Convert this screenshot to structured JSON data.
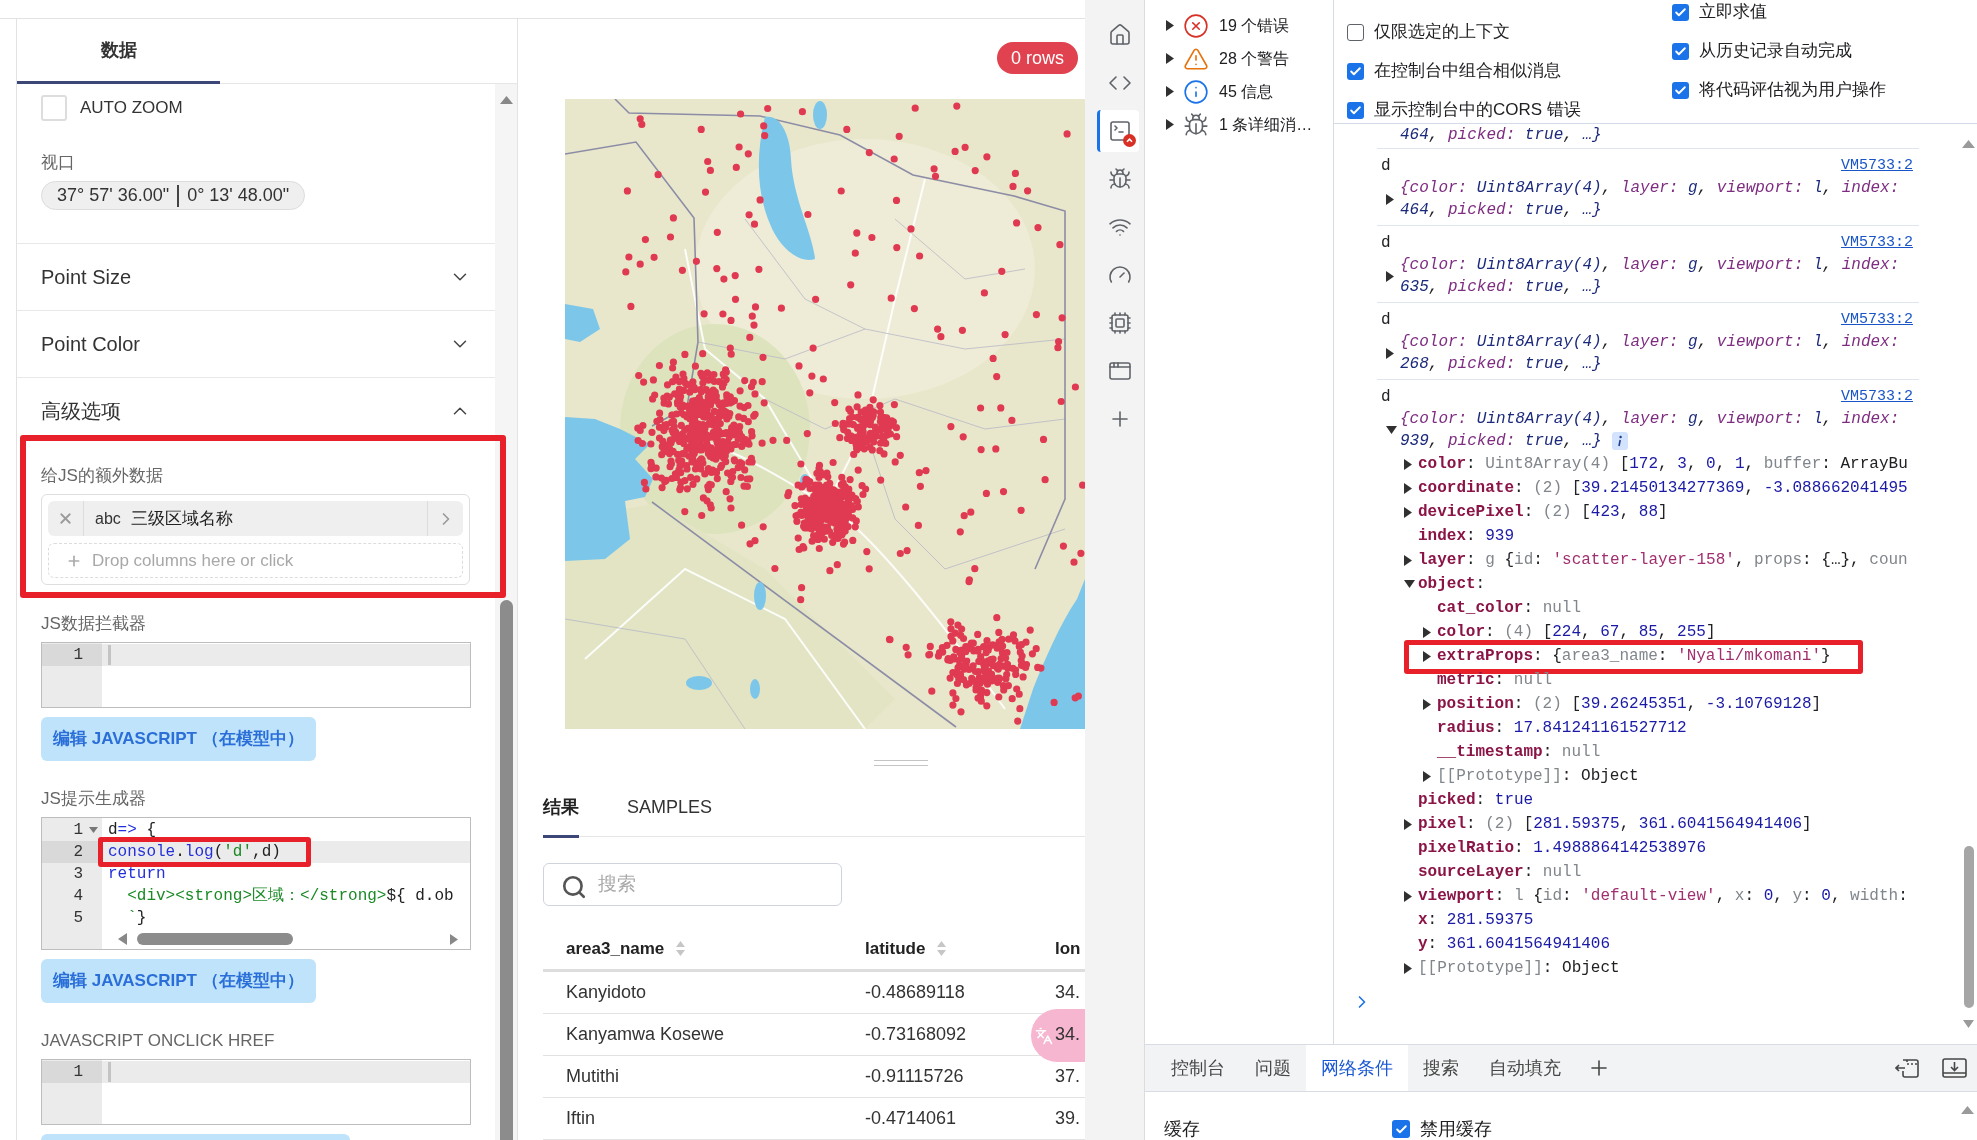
{
  "left_panel": {
    "tabs": [
      {
        "label": "数据",
        "selected": true
      }
    ],
    "auto_zoom": {
      "label": "AUTO ZOOM",
      "checked": false
    },
    "viewport": {
      "label": "视口",
      "latitude": "37° 57' 36.00\"",
      "longitude": "0° 13' 48.00\""
    },
    "sections": [
      {
        "title": "Point Size",
        "expanded": false
      },
      {
        "title": "Point Color",
        "expanded": false
      },
      {
        "title": "高级选项",
        "expanded": true,
        "body": {
          "extra_data": {
            "label": "给JS的额外数据",
            "annotated": true,
            "columns": [
              {
                "type": "abc",
                "name": "三级区域名称"
              }
            ],
            "drop_placeholder": "Drop columns here or click"
          },
          "editors": [
            {
              "label": "JS数据拦截器",
              "cursor": true,
              "h_scroll": false,
              "lines": [
                {
                  "number": "1",
                  "active": true,
                  "foldable": false,
                  "annotated": false
                }
              ],
              "has_button": true,
              "button": "编辑 JAVASCRIPT （在模型中）"
            },
            {
              "label": "JS提示生成器",
              "cursor": false,
              "h_scroll": true,
              "lines": [
                {
                  "number": "1",
                  "active": false,
                  "foldable": true,
                  "annotated": false,
                  "tokens": [
                    {
                      "kind": "plain",
                      "text": "d"
                    },
                    {
                      "kind": "keyword",
                      "text": "=>"
                    },
                    {
                      "kind": "plain",
                      "text": " {"
                    }
                  ]
                },
                {
                  "number": "2",
                  "active": true,
                  "foldable": false,
                  "annotated": true,
                  "tokens": [
                    {
                      "kind": "keyword",
                      "text": "console"
                    },
                    {
                      "kind": "plain",
                      "text": "."
                    },
                    {
                      "kind": "keyword",
                      "text": "log"
                    },
                    {
                      "kind": "plain",
                      "text": "("
                    },
                    {
                      "kind": "string",
                      "text": "'d'"
                    },
                    {
                      "kind": "plain",
                      "text": ",d)"
                    }
                  ]
                },
                {
                  "number": "3",
                  "active": false,
                  "foldable": false,
                  "annotated": false,
                  "tokens": [
                    {
                      "kind": "keyword",
                      "text": "return"
                    }
                  ]
                },
                {
                  "number": "4",
                  "active": false,
                  "foldable": false,
                  "annotated": false,
                  "tokens": [
                    {
                      "kind": "string",
                      "text": "  <div><strong>区域：</strong>"
                    },
                    {
                      "kind": "plain",
                      "text": "${ d.ob"
                    }
                  ]
                },
                {
                  "number": "5",
                  "active": false,
                  "foldable": false,
                  "annotated": false,
                  "tokens": [
                    {
                      "kind": "string",
                      "text": "  `"
                    },
                    {
                      "kind": "plain",
                      "text": "}"
                    }
                  ]
                }
              ],
              "has_button": true,
              "button": "编辑 JAVASCRIPT （在模型中）"
            },
            {
              "label": "JAVASCRIPT ONCLICK HREF",
              "cursor": true,
              "h_scroll": false,
              "lines": [
                {
                  "number": "1",
                  "active": true,
                  "foldable": false,
                  "annotated": false
                }
              ],
              "has_button": true
            }
          ]
        }
      }
    ]
  },
  "results": {
    "row_count": "0 rows",
    "tabs": [
      {
        "label": "结果",
        "selected": true
      },
      {
        "label": "SAMPLES",
        "selected": false
      }
    ],
    "search": {
      "placeholder": "搜索"
    },
    "table": {
      "columns": [
        {
          "label": "area3_name",
          "sortable": true
        },
        {
          "label": "latitude",
          "sortable": true
        },
        {
          "label": "lon",
          "sortable": false
        }
      ],
      "rows": [
        [
          "Kanyidoto",
          "-0.48689118",
          "34."
        ],
        [
          "Kanyamwa Kosewe",
          "-0.73168092",
          "34."
        ],
        [
          "Mutithi",
          "-0.91115726",
          "37."
        ],
        [
          "Iftin",
          "-0.4714061",
          "39."
        ]
      ]
    }
  },
  "devtools": {
    "activity_bar": [
      {
        "selected": false,
        "badge": false
      },
      {
        "selected": false,
        "badge": false
      },
      {
        "selected": true,
        "badge": true
      },
      {
        "selected": false,
        "badge": false
      },
      {
        "selected": false,
        "badge": false
      },
      {
        "selected": false,
        "badge": false
      },
      {
        "selected": false,
        "badge": false
      },
      {
        "selected": false,
        "badge": false
      },
      {
        "selected": false,
        "badge": false
      }
    ],
    "message_filters": [
      {
        "kind": "error",
        "label": "19 个错误",
        "expanded": false
      },
      {
        "kind": "warning",
        "label": "28 个警告",
        "expanded": false
      },
      {
        "kind": "info",
        "label": "45 信息",
        "expanded": false
      },
      {
        "kind": "verbose",
        "label": "1 条详细消…",
        "expanded": false
      }
    ],
    "console_settings": [
      [
        {
          "label": "仅限选定的上下文",
          "checked": false
        },
        {
          "label": "在控制台中组合相似消息",
          "checked": true
        },
        {
          "label": "显示控制台中的CORS 错误",
          "checked": true
        }
      ],
      [
        {
          "label": "立即求值",
          "checked": true
        },
        {
          "label": "从历史记录自动完成",
          "checked": true
        },
        {
          "label": "将代码评估视为用户操作",
          "checked": true
        }
      ]
    ],
    "console": {
      "tail": [
        {
          "kind": "pval",
          "text": "464"
        },
        {
          "kind": "plain",
          "text": ", "
        },
        {
          "kind": "pkey",
          "text": "picked:"
        },
        {
          "kind": "pval",
          "text": " true"
        },
        {
          "kind": "plain",
          "text": ", "
        },
        {
          "kind": "pval",
          "text": "…}"
        }
      ],
      "messages": [
        {
          "label": "d",
          "source": "VM5733:2",
          "expanded": false,
          "preview": [
            [
              {
                "kind": "pkey",
                "text": "{color:"
              },
              {
                "kind": "pval",
                "text": " Uint8Array(4)"
              },
              {
                "kind": "plain",
                "text": ", "
              },
              {
                "kind": "pkey",
                "text": "layer:"
              },
              {
                "kind": "pval",
                "text": " g"
              },
              {
                "kind": "plain",
                "text": ", "
              },
              {
                "kind": "pkey",
                "text": "viewport:"
              },
              {
                "kind": "pval",
                "text": " l"
              },
              {
                "kind": "plain",
                "text": ", "
              },
              {
                "kind": "pkey",
                "text": "index:"
              }
            ],
            [
              {
                "kind": "pval",
                "text": "464"
              },
              {
                "kind": "plain",
                "text": ", "
              },
              {
                "kind": "pkey",
                "text": "picked:"
              },
              {
                "kind": "pval",
                "text": " true"
              },
              {
                "kind": "plain",
                "text": ", "
              },
              {
                "kind": "pval",
                "text": "…}"
              }
            ]
          ]
        },
        {
          "label": "d",
          "source": "VM5733:2",
          "expanded": false,
          "preview": [
            [
              {
                "kind": "pkey",
                "text": "{color:"
              },
              {
                "kind": "pval",
                "text": " Uint8Array(4)"
              },
              {
                "kind": "plain",
                "text": ", "
              },
              {
                "kind": "pkey",
                "text": "layer:"
              },
              {
                "kind": "pval",
                "text": " g"
              },
              {
                "kind": "plain",
                "text": ", "
              },
              {
                "kind": "pkey",
                "text": "viewport:"
              },
              {
                "kind": "pval",
                "text": " l"
              },
              {
                "kind": "plain",
                "text": ", "
              },
              {
                "kind": "pkey",
                "text": "index:"
              }
            ],
            [
              {
                "kind": "pval",
                "text": "635"
              },
              {
                "kind": "plain",
                "text": ", "
              },
              {
                "kind": "pkey",
                "text": "picked:"
              },
              {
                "kind": "pval",
                "text": " true"
              },
              {
                "kind": "plain",
                "text": ", "
              },
              {
                "kind": "pval",
                "text": "…}"
              }
            ]
          ]
        },
        {
          "label": "d",
          "source": "VM5733:2",
          "expanded": false,
          "preview": [
            [
              {
                "kind": "pkey",
                "text": "{color:"
              },
              {
                "kind": "pval",
                "text": " Uint8Array(4)"
              },
              {
                "kind": "plain",
                "text": ", "
              },
              {
                "kind": "pkey",
                "text": "layer:"
              },
              {
                "kind": "pval",
                "text": " g"
              },
              {
                "kind": "plain",
                "text": ", "
              },
              {
                "kind": "pkey",
                "text": "viewport:"
              },
              {
                "kind": "pval",
                "text": " l"
              },
              {
                "kind": "plain",
                "text": ", "
              },
              {
                "kind": "pkey",
                "text": "index:"
              }
            ],
            [
              {
                "kind": "pval",
                "text": "268"
              },
              {
                "kind": "plain",
                "text": ", "
              },
              {
                "kind": "pkey",
                "text": "picked:"
              },
              {
                "kind": "pval",
                "text": " true"
              },
              {
                "kind": "plain",
                "text": ", "
              },
              {
                "kind": "pval",
                "text": "…}"
              }
            ]
          ]
        },
        {
          "label": "d",
          "source": "VM5733:2",
          "expanded": true,
          "preview": [
            [
              {
                "kind": "pkey",
                "text": "{color:"
              },
              {
                "kind": "pval",
                "text": " Uint8Array(4)"
              },
              {
                "kind": "plain",
                "text": ", "
              },
              {
                "kind": "pkey",
                "text": "layer:"
              },
              {
                "kind": "pval",
                "text": " g"
              },
              {
                "kind": "plain",
                "text": ", "
              },
              {
                "kind": "pkey",
                "text": "viewport:"
              },
              {
                "kind": "pval",
                "text": " l"
              },
              {
                "kind": "plain",
                "text": ", "
              },
              {
                "kind": "pkey",
                "text": "index:"
              }
            ],
            [
              {
                "kind": "pval",
                "text": "939"
              },
              {
                "kind": "plain",
                "text": ", "
              },
              {
                "kind": "pkey",
                "text": "picked:"
              },
              {
                "kind": "pval",
                "text": " true"
              },
              {
                "kind": "plain",
                "text": ", "
              },
              {
                "kind": "pval",
                "text": "…}"
              }
            ]
          ],
          "children": [
            {
              "kind": "node",
              "expanded": false,
              "tokens": [
                {
                  "kind": "key",
                  "text": "color"
                },
                {
                  "kind": "plain",
                  "text": ": "
                },
                {
                  "kind": "gray",
                  "text": "Uint8Array(4)"
                },
                {
                  "kind": "plain",
                  "text": " ["
                },
                {
                  "kind": "num",
                  "text": "172"
                },
                {
                  "kind": "plain",
                  "text": ", "
                },
                {
                  "kind": "num",
                  "text": "3"
                },
                {
                  "kind": "plain",
                  "text": ", "
                },
                {
                  "kind": "num",
                  "text": "0"
                },
                {
                  "kind": "plain",
                  "text": ", "
                },
                {
                  "kind": "num",
                  "text": "1"
                },
                {
                  "kind": "plain",
                  "text": ", "
                },
                {
                  "kind": "gray",
                  "text": "buffer"
                },
                {
                  "kind": "plain",
                  "text": ": ArrayBu"
                }
              ]
            },
            {
              "kind": "node",
              "expanded": false,
              "tokens": [
                {
                  "kind": "key",
                  "text": "coordinate"
                },
                {
                  "kind": "plain",
                  "text": ": "
                },
                {
                  "kind": "gray",
                  "text": "(2)"
                },
                {
                  "kind": "plain",
                  "text": " ["
                },
                {
                  "kind": "num",
                  "text": "39.21450134277369"
                },
                {
                  "kind": "plain",
                  "text": ", "
                },
                {
                  "kind": "num",
                  "text": "-3.088662041495"
                }
              ]
            },
            {
              "kind": "node",
              "expanded": false,
              "tokens": [
                {
                  "kind": "key",
                  "text": "devicePixel"
                },
                {
                  "kind": "plain",
                  "text": ": "
                },
                {
                  "kind": "gray",
                  "text": "(2)"
                },
                {
                  "kind": "plain",
                  "text": " ["
                },
                {
                  "kind": "num",
                  "text": "423"
                },
                {
                  "kind": "plain",
                  "text": ", "
                },
                {
                  "kind": "num",
                  "text": "88"
                },
                {
                  "kind": "plain",
                  "text": "]"
                }
              ]
            },
            {
              "kind": "leaf",
              "tokens": [
                {
                  "kind": "key",
                  "text": "index"
                },
                {
                  "kind": "plain",
                  "text": ": "
                },
                {
                  "kind": "num",
                  "text": "939"
                }
              ]
            },
            {
              "kind": "node",
              "expanded": false,
              "tokens": [
                {
                  "kind": "key",
                  "text": "layer"
                },
                {
                  "kind": "plain",
                  "text": ": "
                },
                {
                  "kind": "gray",
                  "text": "g"
                },
                {
                  "kind": "plain",
                  "text": " {"
                },
                {
                  "kind": "gray",
                  "text": "id"
                },
                {
                  "kind": "plain",
                  "text": ": "
                },
                {
                  "kind": "str",
                  "text": "'scatter-layer-158'"
                },
                {
                  "kind": "plain",
                  "text": ", "
                },
                {
                  "kind": "gray",
                  "text": "props"
                },
                {
                  "kind": "plain",
                  "text": ": {…}, "
                },
                {
                  "kind": "gray",
                  "text": "coun"
                }
              ]
            },
            {
              "kind": "node",
              "expanded": true,
              "tokens": [
                {
                  "kind": "key",
                  "text": "object"
                },
                {
                  "kind": "plain",
                  "text": ":"
                }
              ],
              "children": [
                {
                  "kind": "leaf",
                  "annotated": false,
                  "tokens": [
                    {
                      "kind": "key",
                      "text": "cat_color"
                    },
                    {
                      "kind": "plain",
                      "text": ": "
                    },
                    {
                      "kind": "gray",
                      "text": "null"
                    }
                  ]
                },
                {
                  "kind": "node",
                  "expanded": false,
                  "annotated": false,
                  "tokens": [
                    {
                      "kind": "key",
                      "text": "color"
                    },
                    {
                      "kind": "plain",
                      "text": ": "
                    },
                    {
                      "kind": "gray",
                      "text": "(4)"
                    },
                    {
                      "kind": "plain",
                      "text": " ["
                    },
                    {
                      "kind": "num",
                      "text": "224"
                    },
                    {
                      "kind": "plain",
                      "text": ", "
                    },
                    {
                      "kind": "num",
                      "text": "67"
                    },
                    {
                      "kind": "plain",
                      "text": ", "
                    },
                    {
                      "kind": "num",
                      "text": "85"
                    },
                    {
                      "kind": "plain",
                      "text": ", "
                    },
                    {
                      "kind": "num",
                      "text": "255"
                    },
                    {
                      "kind": "plain",
                      "text": "]"
                    }
                  ]
                },
                {
                  "kind": "node",
                  "expanded": false,
                  "annotated": true,
                  "tokens": [
                    {
                      "kind": "key",
                      "text": "extraProps"
                    },
                    {
                      "kind": "plain",
                      "text": ": {"
                    },
                    {
                      "kind": "gray",
                      "text": "area3_name"
                    },
                    {
                      "kind": "plain",
                      "text": ": "
                    },
                    {
                      "kind": "str",
                      "text": "'Nyali/mkomani'"
                    },
                    {
                      "kind": "plain",
                      "text": "}"
                    }
                  ]
                },
                {
                  "kind": "leaf",
                  "annotated": false,
                  "tokens": [
                    {
                      "kind": "key",
                      "text": "metric"
                    },
                    {
                      "kind": "plain",
                      "text": ": "
                    },
                    {
                      "kind": "gray",
                      "text": "null"
                    }
                  ]
                },
                {
                  "kind": "node",
                  "expanded": false,
                  "annotated": false,
                  "tokens": [
                    {
                      "kind": "key",
                      "text": "position"
                    },
                    {
                      "kind": "plain",
                      "text": ": "
                    },
                    {
                      "kind": "gray",
                      "text": "(2)"
                    },
                    {
                      "kind": "plain",
                      "text": " ["
                    },
                    {
                      "kind": "num",
                      "text": "39.26245351"
                    },
                    {
                      "kind": "plain",
                      "text": ", "
                    },
                    {
                      "kind": "num",
                      "text": "-3.10769128"
                    },
                    {
                      "kind": "plain",
                      "text": "]"
                    }
                  ]
                },
                {
                  "kind": "leaf",
                  "annotated": false,
                  "tokens": [
                    {
                      "kind": "key",
                      "text": "radius"
                    },
                    {
                      "kind": "plain",
                      "text": ": "
                    },
                    {
                      "kind": "num",
                      "text": "17.841241161527712"
                    }
                  ]
                },
                {
                  "kind": "leaf",
                  "annotated": false,
                  "tokens": [
                    {
                      "kind": "key",
                      "text": "__timestamp"
                    },
                    {
                      "kind": "plain",
                      "text": ": "
                    },
                    {
                      "kind": "gray",
                      "text": "null"
                    }
                  ]
                },
                {
                  "kind": "node",
                  "expanded": false,
                  "annotated": false,
                  "tokens": [
                    {
                      "kind": "gray",
                      "text": "[[Prototype]]"
                    },
                    {
                      "kind": "plain",
                      "text": ": Object"
                    }
                  ]
                }
              ]
            },
            {
              "kind": "leaf",
              "tokens": [
                {
                  "kind": "key",
                  "text": "picked"
                },
                {
                  "kind": "plain",
                  "text": ": "
                },
                {
                  "kind": "num",
                  "text": "true"
                }
              ]
            },
            {
              "kind": "node",
              "expanded": false,
              "tokens": [
                {
                  "kind": "key",
                  "text": "pixel"
                },
                {
                  "kind": "plain",
                  "text": ": "
                },
                {
                  "kind": "gray",
                  "text": "(2)"
                },
                {
                  "kind": "plain",
                  "text": " ["
                },
                {
                  "kind": "num",
                  "text": "281.59375"
                },
                {
                  "kind": "plain",
                  "text": ", "
                },
                {
                  "kind": "num",
                  "text": "361.6041564941406"
                },
                {
                  "kind": "plain",
                  "text": "]"
                }
              ]
            },
            {
              "kind": "leaf",
              "tokens": [
                {
                  "kind": "key",
                  "text": "pixelRatio"
                },
                {
                  "kind": "plain",
                  "text": ": "
                },
                {
                  "kind": "num",
                  "text": "1.4988864142538976"
                }
              ]
            },
            {
              "kind": "leaf",
              "tokens": [
                {
                  "kind": "key",
                  "text": "sourceLayer"
                },
                {
                  "kind": "plain",
                  "text": ": "
                },
                {
                  "kind": "gray",
                  "text": "null"
                }
              ]
            },
            {
              "kind": "node",
              "expanded": false,
              "tokens": [
                {
                  "kind": "key",
                  "text": "viewport"
                },
                {
                  "kind": "plain",
                  "text": ": "
                },
                {
                  "kind": "gray",
                  "text": "l"
                },
                {
                  "kind": "plain",
                  "text": " {"
                },
                {
                  "kind": "gray",
                  "text": "id"
                },
                {
                  "kind": "plain",
                  "text": ": "
                },
                {
                  "kind": "str",
                  "text": "'default-view'"
                },
                {
                  "kind": "plain",
                  "text": ", "
                },
                {
                  "kind": "gray",
                  "text": "x"
                },
                {
                  "kind": "plain",
                  "text": ": "
                },
                {
                  "kind": "num",
                  "text": "0"
                },
                {
                  "kind": "plain",
                  "text": ", "
                },
                {
                  "kind": "gray",
                  "text": "y"
                },
                {
                  "kind": "plain",
                  "text": ": "
                },
                {
                  "kind": "num",
                  "text": "0"
                },
                {
                  "kind": "plain",
                  "text": ", "
                },
                {
                  "kind": "gray",
                  "text": "width"
                },
                {
                  "kind": "plain",
                  "text": ":"
                }
              ]
            },
            {
              "kind": "leaf",
              "tokens": [
                {
                  "kind": "key",
                  "text": "x"
                },
                {
                  "kind": "plain",
                  "text": ": "
                },
                {
                  "kind": "num",
                  "text": "281.59375"
                }
              ]
            },
            {
              "kind": "leaf",
              "tokens": [
                {
                  "kind": "key",
                  "text": "y"
                },
                {
                  "kind": "plain",
                  "text": ": "
                },
                {
                  "kind": "num",
                  "text": "361.6041564941406"
                }
              ]
            },
            {
              "kind": "node",
              "expanded": false,
              "tokens": [
                {
                  "kind": "gray",
                  "text": "[[Prototype]]"
                },
                {
                  "kind": "plain",
                  "text": ": Object"
                }
              ]
            }
          ]
        }
      ]
    },
    "drawer_tabs": [
      {
        "label": "控制台",
        "selected": false
      },
      {
        "label": "问题",
        "selected": false
      },
      {
        "label": "网络条件",
        "selected": true
      },
      {
        "label": "搜索",
        "selected": false
      },
      {
        "label": "自动填充",
        "selected": false
      }
    ],
    "network_conditions": {
      "label": "缓存",
      "options": [
        {
          "label": "禁用缓存",
          "checked": true
        }
      ]
    }
  }
}
